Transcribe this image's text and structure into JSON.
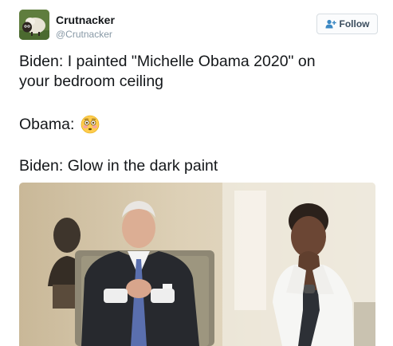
{
  "tweet": {
    "author": {
      "display_name": "Crutnacker",
      "handle": "@Crutnacker",
      "avatar_icon": "sheep-avatar-icon"
    },
    "follow_button": {
      "label": "Follow",
      "icon": "add-user-icon"
    },
    "lines": {
      "line1": "Biden: I painted \"Michelle Obama 2020\" on",
      "line2": "your bedroom ceiling",
      "line3": "Obama:",
      "line3_emoji": "flushed-face-emoji",
      "line4": "Biden: Glow in the dark paint"
    },
    "media": {
      "type": "photo"
    }
  },
  "colors": {
    "text": "#14171a",
    "secondary": "#8899a6",
    "follow_text": "#3b4d5e",
    "button_border": "#d7dde2"
  }
}
